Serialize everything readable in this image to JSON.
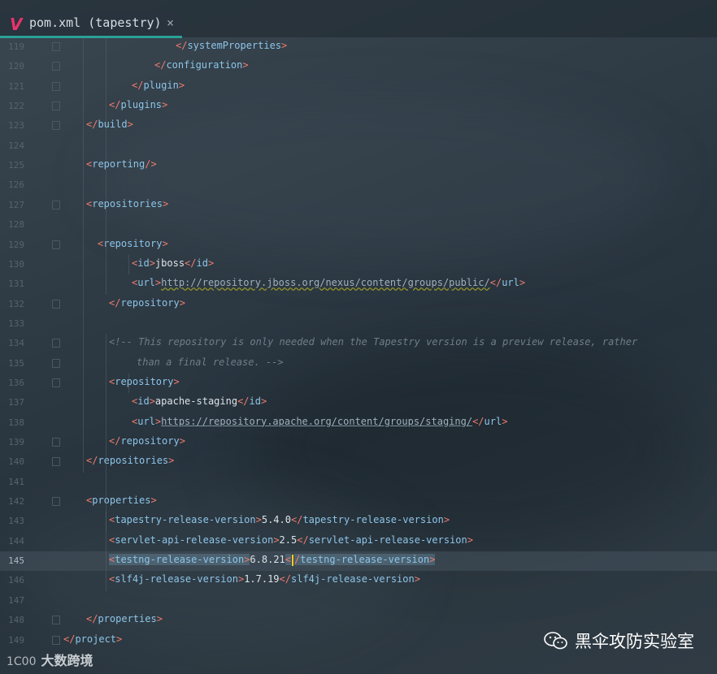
{
  "tab": {
    "logo": "V",
    "title": "pom.xml (tapestry)",
    "close": "×"
  },
  "editor": {
    "lines": [
      {
        "num": "119",
        "indent": 216,
        "parts": [
          [
            "t",
            "</"
          ],
          [
            "n",
            "systemProperties"
          ],
          [
            "t",
            ">"
          ]
        ]
      },
      {
        "num": "120",
        "indent": 190,
        "parts": [
          [
            "t",
            "</"
          ],
          [
            "n",
            "configuration"
          ],
          [
            "t",
            ">"
          ]
        ]
      },
      {
        "num": "121",
        "indent": 162,
        "parts": [
          [
            "t",
            "</"
          ],
          [
            "n",
            "plugin"
          ],
          [
            "t",
            ">"
          ]
        ]
      },
      {
        "num": "122",
        "indent": 134,
        "parts": [
          [
            "t",
            "</"
          ],
          [
            "n",
            "plugins"
          ],
          [
            "t",
            ">"
          ]
        ]
      },
      {
        "num": "123",
        "indent": 106,
        "parts": [
          [
            "t",
            "</"
          ],
          [
            "n",
            "build"
          ],
          [
            "t",
            ">"
          ]
        ]
      },
      {
        "num": "124",
        "indent": 106,
        "parts": []
      },
      {
        "num": "125",
        "indent": 106,
        "parts": [
          [
            "t",
            "<"
          ],
          [
            "n",
            "reporting"
          ],
          [
            "t",
            "/>"
          ]
        ]
      },
      {
        "num": "126",
        "indent": 106,
        "parts": []
      },
      {
        "num": "127",
        "indent": 106,
        "parts": [
          [
            "t",
            "<"
          ],
          [
            "n",
            "repositories"
          ],
          [
            "t",
            ">"
          ]
        ]
      },
      {
        "num": "128",
        "indent": 106,
        "parts": []
      },
      {
        "num": "129",
        "indent": 120,
        "parts": [
          [
            "t",
            "<"
          ],
          [
            "n",
            "repository"
          ],
          [
            "t",
            ">"
          ]
        ]
      },
      {
        "num": "130",
        "indent": 162,
        "parts": [
          [
            "t",
            "<"
          ],
          [
            "n",
            "id"
          ],
          [
            "t",
            ">"
          ],
          [
            "txt",
            "jboss"
          ],
          [
            "t",
            "</"
          ],
          [
            "n",
            "id"
          ],
          [
            "t",
            ">"
          ]
        ]
      },
      {
        "num": "131",
        "indent": 162,
        "parts": [
          [
            "t",
            "<"
          ],
          [
            "n",
            "url"
          ],
          [
            "t",
            ">"
          ],
          [
            "urlw",
            "http://repository.jboss.org/nexus/content/groups/public/"
          ],
          [
            "t",
            "</"
          ],
          [
            "n",
            "url"
          ],
          [
            "t",
            ">"
          ]
        ]
      },
      {
        "num": "132",
        "indent": 134,
        "parts": [
          [
            "t",
            "</"
          ],
          [
            "n",
            "repository"
          ],
          [
            "t",
            ">"
          ]
        ]
      },
      {
        "num": "133",
        "indent": 134,
        "parts": []
      },
      {
        "num": "134",
        "indent": 134,
        "parts": [
          [
            "cmt",
            "<!-- This repository is only needed when the Tapestry version is a preview release, rather"
          ]
        ]
      },
      {
        "num": "135",
        "indent": 168,
        "parts": [
          [
            "cmt",
            "than a final release. -->"
          ]
        ]
      },
      {
        "num": "136",
        "indent": 134,
        "parts": [
          [
            "t",
            "<"
          ],
          [
            "n",
            "repository"
          ],
          [
            "t",
            ">"
          ]
        ]
      },
      {
        "num": "137",
        "indent": 162,
        "parts": [
          [
            "t",
            "<"
          ],
          [
            "n",
            "id"
          ],
          [
            "t",
            ">"
          ],
          [
            "txt",
            "apache-staging"
          ],
          [
            "t",
            "</"
          ],
          [
            "n",
            "id"
          ],
          [
            "t",
            ">"
          ]
        ]
      },
      {
        "num": "138",
        "indent": 162,
        "parts": [
          [
            "t",
            "<"
          ],
          [
            "n",
            "url"
          ],
          [
            "t",
            ">"
          ],
          [
            "url",
            "https://repository.apache.org/content/groups/staging/"
          ],
          [
            "t",
            "</"
          ],
          [
            "n",
            "url"
          ],
          [
            "t",
            ">"
          ]
        ]
      },
      {
        "num": "139",
        "indent": 134,
        "parts": [
          [
            "t",
            "</"
          ],
          [
            "n",
            "repository"
          ],
          [
            "t",
            ">"
          ]
        ]
      },
      {
        "num": "140",
        "indent": 106,
        "parts": [
          [
            "t",
            "</"
          ],
          [
            "n",
            "repositories"
          ],
          [
            "t",
            ">"
          ]
        ]
      },
      {
        "num": "141",
        "indent": 106,
        "parts": []
      },
      {
        "num": "142",
        "indent": 106,
        "parts": [
          [
            "t",
            "<"
          ],
          [
            "n",
            "properties"
          ],
          [
            "t",
            ">"
          ]
        ]
      },
      {
        "num": "143",
        "indent": 134,
        "parts": [
          [
            "t",
            "<"
          ],
          [
            "n",
            "tapestry-release-version"
          ],
          [
            "t",
            ">"
          ],
          [
            "txt",
            "5.4.0"
          ],
          [
            "t",
            "</"
          ],
          [
            "n",
            "tapestry-release-version"
          ],
          [
            "t",
            ">"
          ]
        ]
      },
      {
        "num": "144",
        "indent": 134,
        "parts": [
          [
            "t",
            "<"
          ],
          [
            "n",
            "servlet-api-release-version"
          ],
          [
            "t",
            ">"
          ],
          [
            "txt",
            "2.5"
          ],
          [
            "t",
            "</"
          ],
          [
            "n",
            "servlet-api-release-version"
          ],
          [
            "t",
            ">"
          ]
        ]
      },
      {
        "num": "145",
        "indent": 134,
        "current": true,
        "parts": [
          [
            "hlt",
            "<"
          ],
          [
            "hln",
            "testng-release-version"
          ],
          [
            "hlt",
            ">"
          ],
          [
            "txt",
            "6.8.21"
          ],
          [
            "hlt",
            "<"
          ],
          [
            "caret",
            ""
          ],
          [
            "hlt",
            "/"
          ],
          [
            "hln",
            "testng-release-version"
          ],
          [
            "hlt",
            ">"
          ]
        ]
      },
      {
        "num": "146",
        "indent": 134,
        "parts": [
          [
            "t",
            "<"
          ],
          [
            "n",
            "slf4j-release-version"
          ],
          [
            "t",
            ">"
          ],
          [
            "txt",
            "1.7.19"
          ],
          [
            "t",
            "</"
          ],
          [
            "n",
            "slf4j-release-version"
          ],
          [
            "t",
            ">"
          ]
        ]
      },
      {
        "num": "147",
        "indent": 106,
        "parts": []
      },
      {
        "num": "148",
        "indent": 106,
        "parts": [
          [
            "t",
            "</"
          ],
          [
            "n",
            "properties"
          ],
          [
            "t",
            ">"
          ]
        ]
      },
      {
        "num": "149",
        "indent": 78,
        "parts": [
          [
            "t",
            "</"
          ],
          [
            "n",
            "project"
          ],
          [
            "t",
            ">"
          ]
        ]
      }
    ]
  },
  "watermark": {
    "right_text": "黑伞攻防实验室",
    "left_text": "大数跨境",
    "left_logo": "1C00"
  },
  "colors": {
    "tag": "#ed7c6d",
    "name": "#8dc5e8",
    "accent": "#2aa198",
    "caret": "#f0d020"
  }
}
